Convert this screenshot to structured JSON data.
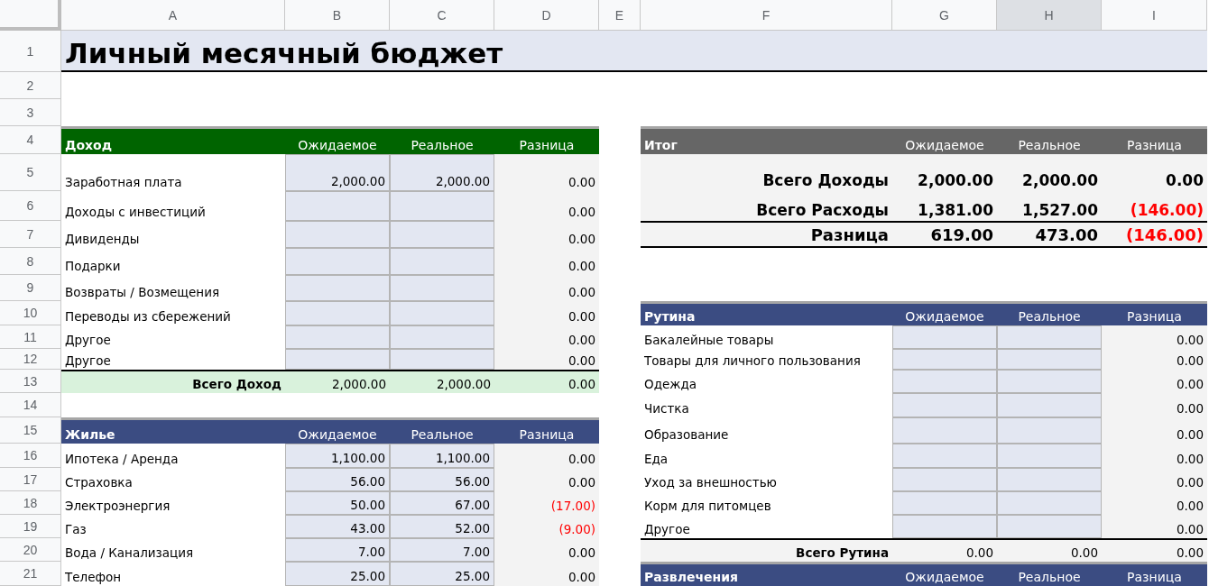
{
  "column_headers": [
    {
      "label": "A",
      "selected": false
    },
    {
      "label": "B",
      "selected": false
    },
    {
      "label": "C",
      "selected": false
    },
    {
      "label": "D",
      "selected": false
    },
    {
      "label": "E",
      "selected": false
    },
    {
      "label": "F",
      "selected": false
    },
    {
      "label": "G",
      "selected": false
    },
    {
      "label": "H",
      "selected": true
    },
    {
      "label": "I",
      "selected": false
    }
  ],
  "row_numbers": [
    "1",
    "2",
    "3",
    "4",
    "5",
    "6",
    "7",
    "8",
    "9",
    "10",
    "11",
    "12",
    "13",
    "14",
    "15",
    "16",
    "17",
    "18",
    "19",
    "20",
    "21"
  ],
  "title": "Личный месячный бюджет",
  "income": {
    "header": {
      "label": "Доход",
      "color": "#006400",
      "columns": [
        "Ожидаемое",
        "Реальное",
        "Разница"
      ]
    },
    "rows": [
      {
        "label": "Заработная плата",
        "expected": "2,000.00",
        "actual": "2,000.00",
        "difference": "0.00",
        "negative": false
      },
      {
        "label": "Доходы с инвестиций",
        "difference": "0.00",
        "negative": false
      },
      {
        "label": "Дивиденды",
        "difference": "0.00",
        "negative": false
      },
      {
        "label": "Подарки",
        "difference": "0.00",
        "negative": false
      },
      {
        "label": "Возвраты / Возмещения",
        "difference": "0.00",
        "negative": false
      },
      {
        "label": "Переводы из сбережений",
        "difference": "0.00",
        "negative": false
      },
      {
        "label": "Другое",
        "difference": "0.00",
        "negative": false
      },
      {
        "label": "Другое",
        "difference": "0.00",
        "negative": false
      }
    ],
    "total": {
      "label": "Всего Доход",
      "expected": "2,000.00",
      "actual": "2,000.00",
      "difference": "0.00",
      "negative": false,
      "color": "#d9f2dc"
    }
  },
  "housing": {
    "header": {
      "label": "Жилье",
      "color": "#3b4c82",
      "columns": [
        "Ожидаемое",
        "Реальное",
        "Разница"
      ]
    },
    "rows": [
      {
        "label": "Ипотека / Аренда",
        "expected": "1,100.00",
        "actual": "1,100.00",
        "difference": "0.00",
        "negative": false
      },
      {
        "label": "Страховка",
        "expected": "56.00",
        "actual": "56.00",
        "difference": "0.00",
        "negative": false
      },
      {
        "label": "Электроэнергия",
        "expected": "50.00",
        "actual": "67.00",
        "difference": "(17.00)",
        "negative": true
      },
      {
        "label": "Газ",
        "expected": "43.00",
        "actual": "52.00",
        "difference": "(9.00)",
        "negative": true
      },
      {
        "label": "Вода / Канализация",
        "expected": "7.00",
        "actual": "7.00",
        "difference": "0.00",
        "negative": false
      },
      {
        "label": "Телефон",
        "expected": "25.00",
        "actual": "25.00",
        "difference": "0.00",
        "negative": false
      }
    ]
  },
  "summary": {
    "header": {
      "label": "Итог",
      "color": "#666666",
      "columns": [
        "Ожидаемое",
        "Реальное",
        "Разница"
      ]
    },
    "rows": [
      {
        "kind": "subtotal",
        "label": "Всего Доходы",
        "expected": "2,000.00",
        "actual": "2,000.00",
        "difference": "0.00",
        "negative": false
      },
      {
        "kind": "subtotal",
        "label": "Всего Расходы",
        "expected": "1,381.00",
        "actual": "1,527.00",
        "difference": "(146.00)",
        "negative": true
      },
      {
        "kind": "net",
        "label": "Разница",
        "expected": "619.00",
        "actual": "473.00",
        "difference": "(146.00)",
        "negative": true
      }
    ]
  },
  "routine": {
    "header": {
      "label": "Рутина",
      "color": "#3b4c82",
      "columns": [
        "Ожидаемое",
        "Реальное",
        "Разница"
      ]
    },
    "rows": [
      {
        "label": "Бакалейные товары",
        "difference": "0.00",
        "negative": false
      },
      {
        "label": "Товары для личного пользования",
        "difference": "0.00",
        "negative": false
      },
      {
        "label": "Одежда",
        "difference": "0.00",
        "negative": false
      },
      {
        "label": "Чистка",
        "difference": "0.00",
        "negative": false
      },
      {
        "label": "Образование",
        "difference": "0.00",
        "negative": false
      },
      {
        "label": "Еда",
        "difference": "0.00",
        "negative": false
      },
      {
        "label": "Уход за внешностью",
        "difference": "0.00",
        "negative": false
      },
      {
        "label": "Корм для питомцев",
        "difference": "0.00",
        "negative": false
      },
      {
        "label": "Другое",
        "difference": "0.00",
        "negative": false
      }
    ],
    "total": {
      "label": "Всего Рутина",
      "expected": "0.00",
      "actual": "0.00",
      "difference": "0.00",
      "negative": false,
      "color": "#f3f3f3"
    }
  },
  "entertainment": {
    "header": {
      "label": "Развлечения",
      "color": "#3b4c82",
      "columns": [
        "Ожидаемое",
        "Реальное",
        "Разница"
      ]
    }
  }
}
